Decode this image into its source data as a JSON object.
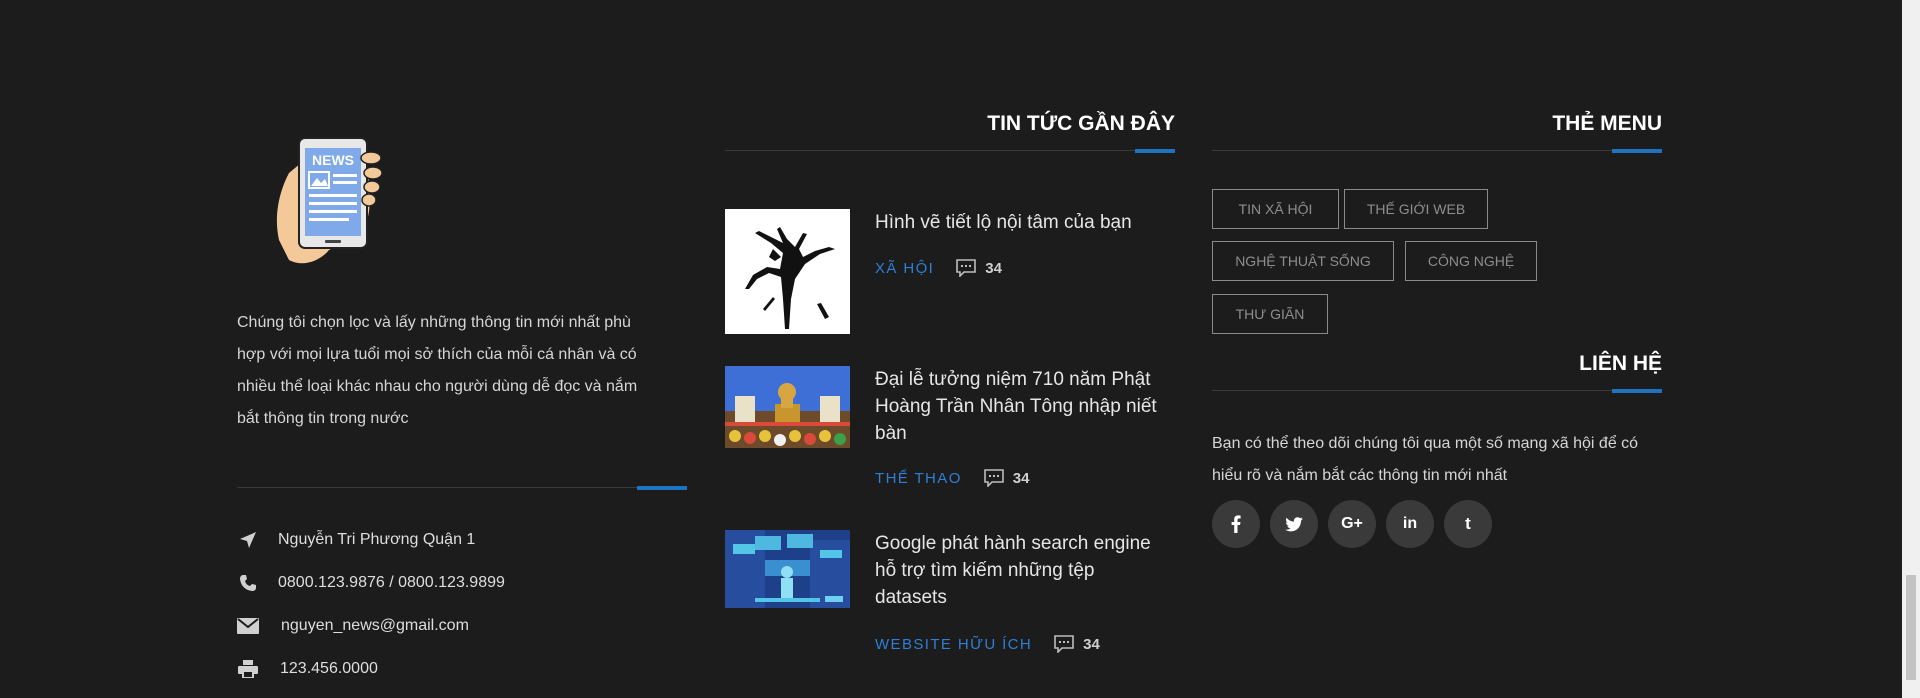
{
  "about": {
    "description": "Chúng tôi chọn lọc và lấy những thông tin mới nhất phù hợp với mọi lựa tuổi mọi sở thích của mỗi cá nhân và có nhiều thể loại khác nhau cho người dùng dễ đọc và nắm bắt thông tin trong nước",
    "logo_text": "NEWS",
    "address": "Nguyễn Tri Phương Quận 1",
    "phone": "0800.123.9876 / 0800.123.9899",
    "email": "nguyen_news@gmail.com",
    "fax": "123.456.0000"
  },
  "recent_news": {
    "heading": "TIN TỨC GẦN ĐÂY",
    "items": [
      {
        "title": "Hình vẽ tiết lộ nội tâm của bạn",
        "category": "XÃ HỘI",
        "comments": "34"
      },
      {
        "title": "Đại lễ tưởng niệm 710 năm Phật Hoàng Trần Nhân Tông nhập niết bàn",
        "category": "THỂ THAO",
        "comments": "34"
      },
      {
        "title": "Google phát hành search engine hỗ trợ tìm kiếm những tệp datasets",
        "category": "WEBSITE HỮU ÍCH",
        "comments": "34"
      }
    ]
  },
  "tags": {
    "heading": "THẺ MENU",
    "items": [
      "TIN XÃ HỘI",
      "THẾ GIỚI WEB",
      "NGHỆ THUẬT SỐNG",
      "CÔNG NGHỆ",
      "THƯ GIÃN"
    ]
  },
  "contact": {
    "heading": "LIÊN HỆ",
    "text": "Bạn có thể theo dõi chúng tôi qua một số mạng xã hội để có hiểu rõ và nắm bắt các thông tin mới nhất",
    "social": [
      "facebook-icon",
      "twitter-icon",
      "google-plus-icon",
      "linkedin-icon",
      "tumblr-icon"
    ]
  },
  "colors": {
    "background": "#1c1c1c",
    "accent": "#1e73be",
    "category": "#2f7fd6"
  }
}
